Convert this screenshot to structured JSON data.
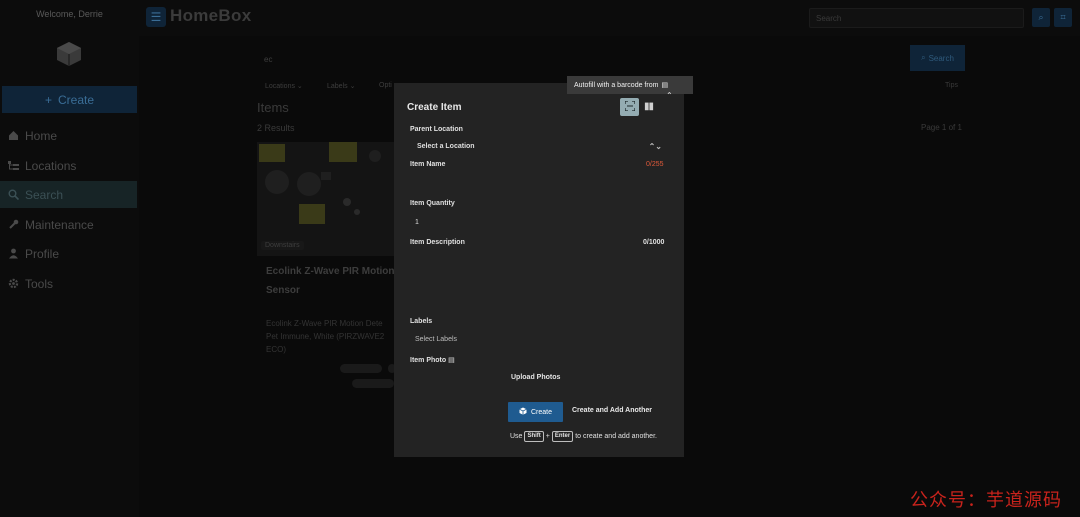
{
  "sidebar": {
    "welcome": "Welcome, Derrie",
    "create_label": "Create",
    "items": [
      {
        "label": "Home",
        "icon": "home-icon"
      },
      {
        "label": "Locations",
        "icon": "tree-icon"
      },
      {
        "label": "Search",
        "icon": "search-icon",
        "active": true
      },
      {
        "label": "Maintenance",
        "icon": "wrench-icon"
      },
      {
        "label": "Profile",
        "icon": "user-icon"
      },
      {
        "label": "Tools",
        "icon": "gear-icon"
      }
    ]
  },
  "topbar": {
    "brand": "HomeBox",
    "search_placeholder": "Search"
  },
  "main": {
    "query": "ec",
    "search_button": "Search",
    "filters": [
      "Locations",
      "Labels",
      "Opti"
    ],
    "tips": "Tips",
    "title": "Items",
    "results": "2 Results",
    "page_info": "Page 1 of 1",
    "card": {
      "location": "Downstairs",
      "title": "Ecolink Z-Wave PIR Motion Sensor",
      "description": "Ecolink Z-Wave PIR Motion Dete Pet Immune, White (PIRZWAVE2 ECO)"
    }
  },
  "modal": {
    "title": "Create Item",
    "autofill_tooltip": "Autofill with a barcode from",
    "parent_location_label": "Parent Location",
    "parent_location_value": "Select a Location",
    "item_name_label": "Item Name",
    "item_name_count": "0/255",
    "item_quantity_label": "Item Quantity",
    "item_quantity_value": "1",
    "item_description_label": "Item Description",
    "item_description_count": "0/1000",
    "labels_label": "Labels",
    "labels_placeholder": "Select Labels",
    "item_photo_label": "Item Photo",
    "upload_label": "Upload Photos",
    "create_label": "Create",
    "create_another_label": "Create and Add Another",
    "hint_use": "Use",
    "hint_key_shift": "Shift",
    "hint_plus": "+",
    "hint_key_enter": "Enter",
    "hint_rest": "to create and add another."
  },
  "watermark": "公众号：芋道源码",
  "colors": {
    "accent": "#1f5b90",
    "error": "#e05a3a",
    "modal_bg": "#232323"
  }
}
